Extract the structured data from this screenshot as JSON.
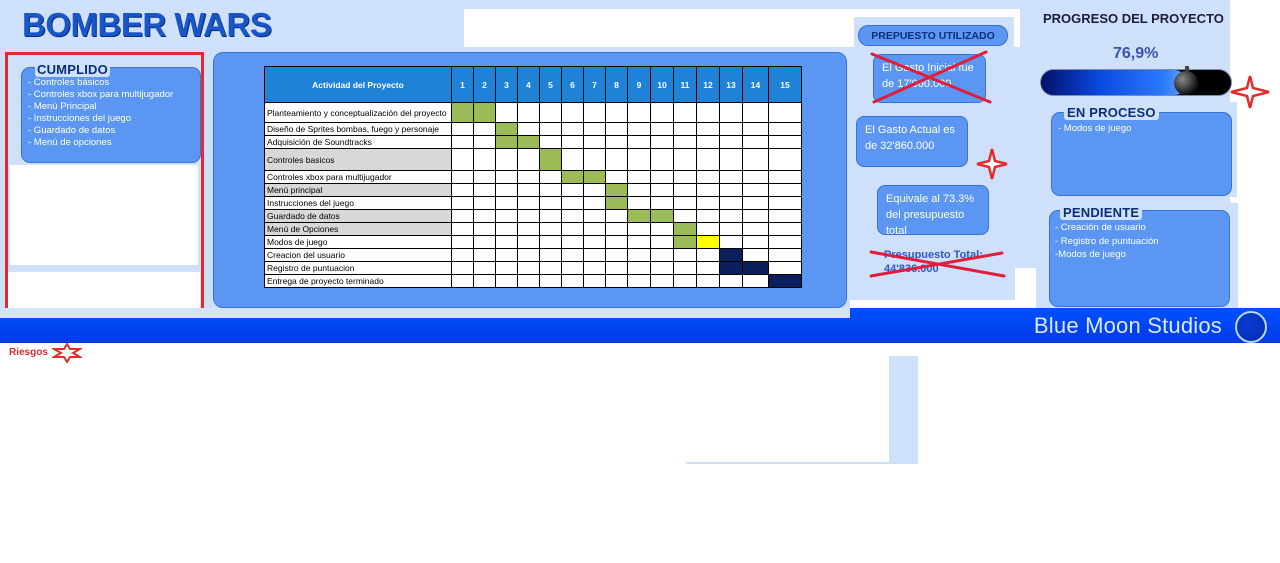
{
  "app_title": "BOMBER WARS",
  "studio_name": "Blue Moon Studios",
  "cumplido": {
    "title": "CUMPLIDO",
    "items": [
      "- Controles básicos",
      "- Controles xbox para multijugador",
      "- Menú Principal",
      "- Instrucciones del juego",
      "- Guardado de datos",
      "- Menú de opciones"
    ]
  },
  "gantt": {
    "activity_header": "Actividad del Proyecto",
    "periods": [
      "1",
      "2",
      "3",
      "4",
      "5",
      "6",
      "7",
      "8",
      "9",
      "10",
      "11",
      "12",
      "13",
      "14",
      "15"
    ],
    "colors": {
      "done": "#9bbb59",
      "in_progress": "#ffff00",
      "pending": "#0b1f5c"
    },
    "rows": [
      {
        "label": "Planteamiento y conceptualización del proyecto",
        "shade": false,
        "done": [
          1,
          2
        ],
        "in_progress": [],
        "pending": []
      },
      {
        "label": "Diseño de Sprites bombas, fuego y personaje",
        "shade": false,
        "done": [
          3
        ],
        "in_progress": [],
        "pending": []
      },
      {
        "label": "Adquisición de Soundtracks",
        "shade": false,
        "done": [
          3,
          4
        ],
        "in_progress": [],
        "pending": []
      },
      {
        "label": "Controles basicos",
        "shade": true,
        "done": [
          5
        ],
        "in_progress": [],
        "pending": []
      },
      {
        "label": "Controles xbox para multijugador",
        "shade": false,
        "done": [
          6,
          7
        ],
        "in_progress": [],
        "pending": []
      },
      {
        "label": "Menú principal",
        "shade": true,
        "done": [
          8
        ],
        "in_progress": [],
        "pending": []
      },
      {
        "label": "Instrucciones del juego",
        "shade": false,
        "done": [
          8
        ],
        "in_progress": [],
        "pending": []
      },
      {
        "label": "Guardado de datos",
        "shade": true,
        "done": [
          9,
          10
        ],
        "in_progress": [],
        "pending": []
      },
      {
        "label": "Menú de Opciones",
        "shade": true,
        "done": [
          11
        ],
        "in_progress": [],
        "pending": []
      },
      {
        "label": "Modos de juego",
        "shade": false,
        "done": [
          11
        ],
        "in_progress": [
          12
        ],
        "pending": []
      },
      {
        "label": "Creacion del usuario",
        "shade": false,
        "done": [],
        "in_progress": [],
        "pending": [
          13
        ]
      },
      {
        "label": "Registro de puntuacion",
        "shade": false,
        "done": [],
        "in_progress": [],
        "pending": [
          13,
          14
        ]
      },
      {
        "label": "Entrega de proyecto terminado",
        "shade": false,
        "done": [],
        "in_progress": [],
        "pending": [
          15
        ]
      }
    ]
  },
  "budget": {
    "title": "PREPUESTO UTILIZADO",
    "initial": "El Gasto Inicial fue de 17'060.000",
    "actual": "El Gasto Actual es de 32'860.000",
    "equivalent": "Equivale al 73.3% del presupuesto total",
    "total": "Presupuesto Total: 44'836.000"
  },
  "progress": {
    "title": "PROGRESO DEL PROYECTO",
    "value_text": "76,9%",
    "fraction": 0.769
  },
  "en_proceso": {
    "title": "EN PROCESO",
    "items": [
      "- Modos de juego"
    ]
  },
  "pendiente": {
    "title": "PENDIENTE",
    "items": [
      "- Creación de usuario",
      "- Registro de puntuación",
      "-Modos de juego"
    ]
  },
  "riesgos_label": "Riesgos",
  "accent_red": "#e32b2b"
}
